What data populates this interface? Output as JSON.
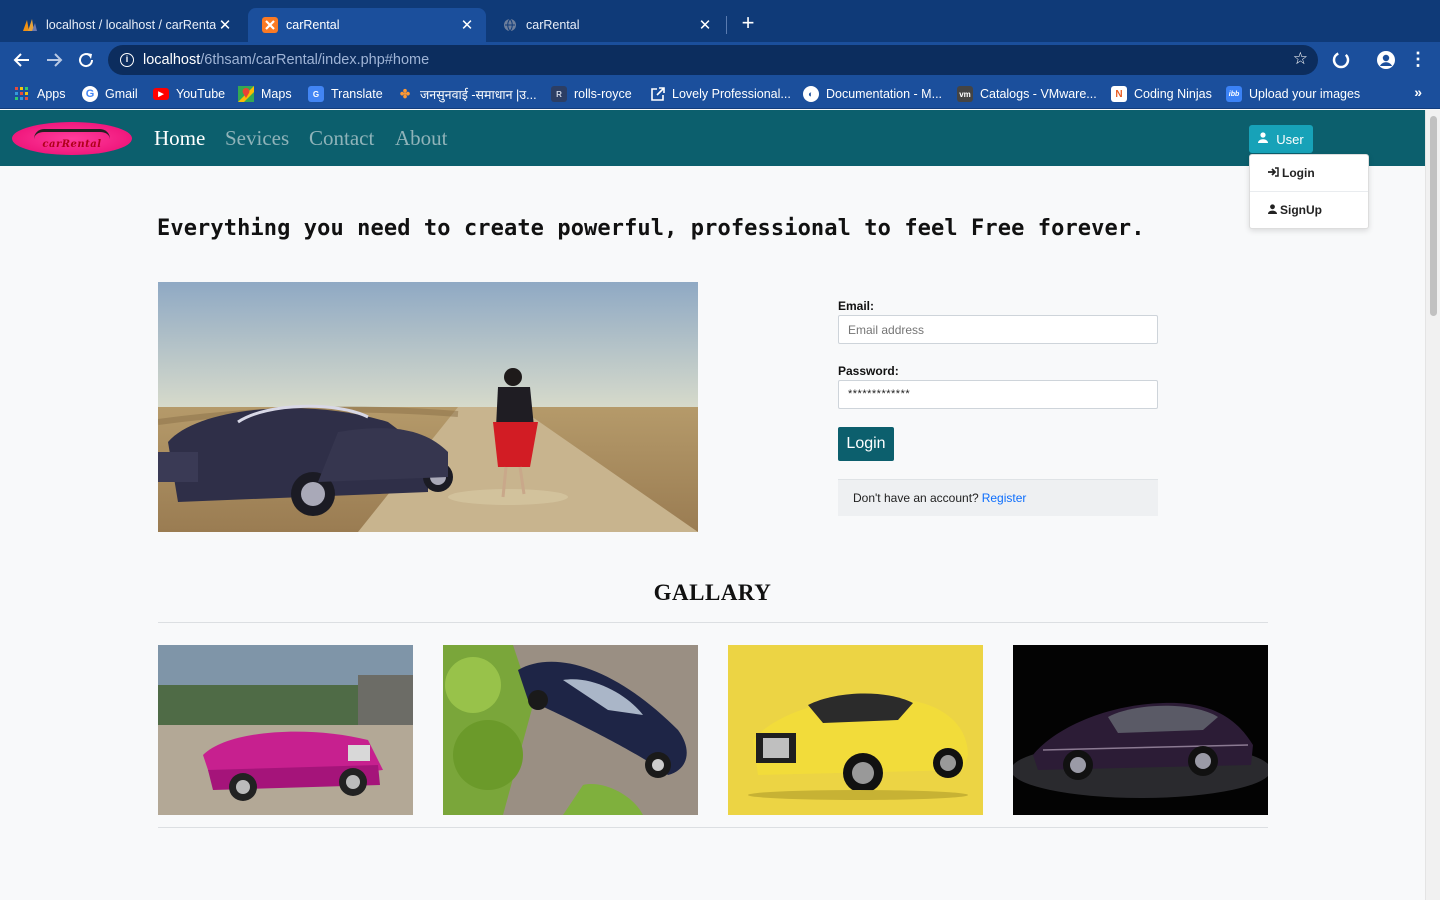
{
  "browser": {
    "tabs": [
      {
        "title": "localhost / localhost / carRental / ",
        "active": false
      },
      {
        "title": "carRental",
        "active": true
      },
      {
        "title": "carRental",
        "active": false
      }
    ],
    "url_host": "localhost",
    "url_path": "/6thsam/carRental/index.php#home",
    "bookmarks": [
      {
        "label": "Apps",
        "icon": "apps-grid-icon"
      },
      {
        "label": "Gmail",
        "icon": "google-icon"
      },
      {
        "label": "YouTube",
        "icon": "youtube-icon"
      },
      {
        "label": "Maps",
        "icon": "maps-icon"
      },
      {
        "label": "Translate",
        "icon": "translate-icon"
      },
      {
        "label": "जनसुनवाई -समाधान |उ...",
        "icon": "emblem-icon"
      },
      {
        "label": "rolls-royce",
        "icon": "rolls-royce-icon"
      },
      {
        "label": "Lovely Professional...",
        "icon": "external-link-icon"
      },
      {
        "label": "Documentation - M...",
        "icon": "documentation-icon"
      },
      {
        "label": "Catalogs - VMware...",
        "icon": "vmware-icon"
      },
      {
        "label": "Coding Ninjas",
        "icon": "coding-ninjas-icon"
      },
      {
        "label": "Upload your images",
        "icon": "ibb-icon"
      }
    ],
    "colors": {
      "chrome": "#1b4f9c",
      "tabstrip": "#0f3a78"
    }
  },
  "navbar": {
    "logo_text": "carRental",
    "links": [
      "Home",
      "Sevices",
      "Contact",
      "About"
    ],
    "user_button": "User",
    "dropdown": [
      "Login",
      "SignUp"
    ],
    "colors": {
      "navbar": "#0c5f6d",
      "user_button": "#17a2b8"
    }
  },
  "hero": {
    "headline": "Everything you need to create powerful, professional to feel Free forever."
  },
  "login_form": {
    "email_label": "Email:",
    "email_placeholder": "Email address",
    "password_label": "Password:",
    "password_value": "*************",
    "submit_label": "Login",
    "footer_text": "Don't have an account?",
    "footer_link": "Register"
  },
  "gallery": {
    "title": "GALLARY",
    "images": [
      "magenta-convertible-photo",
      "navy-coupe-photo",
      "yellow-coupe-photo",
      "dark-purple-sedan-photo"
    ]
  }
}
